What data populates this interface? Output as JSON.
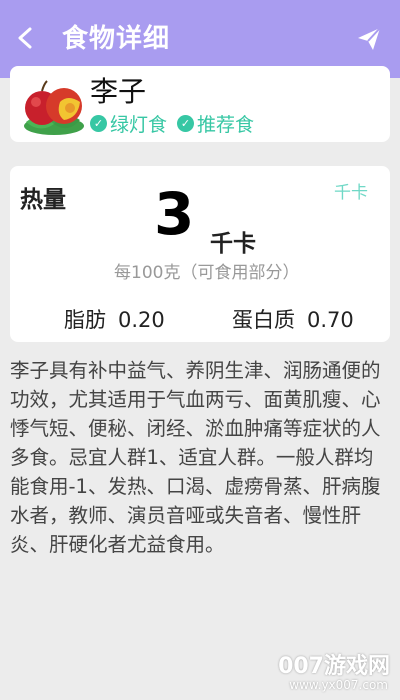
{
  "header": {
    "title": "食物详细",
    "back_icon": "back-arrow-icon",
    "share_icon": "paper-plane-icon",
    "color": "#a99cf0"
  },
  "food": {
    "name": "李子",
    "tags": [
      {
        "label": "绿灯食",
        "icon": "check-circle-icon"
      },
      {
        "label": "推荐食",
        "icon": "check-circle-icon"
      }
    ],
    "tag_color": "#37c7a4"
  },
  "calories": {
    "label": "热量",
    "value": "3",
    "unit": "千卡",
    "unit_link": "千卡",
    "per_note": "每100克（可食用部分）"
  },
  "nutrients": [
    {
      "label": "脂肪",
      "value": "0.20"
    },
    {
      "label": "蛋白质",
      "value": "0.70"
    }
  ],
  "description": "李子具有补中益气、养阴生津、润肠通便的功效，尤其适用于气血两亏、面黄肌瘦、心悸气短、便秘、闭经、淤血肿痛等症状的人多食。忌宜人群1、适宜人群。一般人群均能食用-1、发热、口渴、虚痨骨蒸、肝病腹水者，教师、演员音哑或失音者、慢性肝炎、肝硬化者尤益食用。",
  "watermark": {
    "text": "007游戏网",
    "url": "www.yx007.com"
  }
}
